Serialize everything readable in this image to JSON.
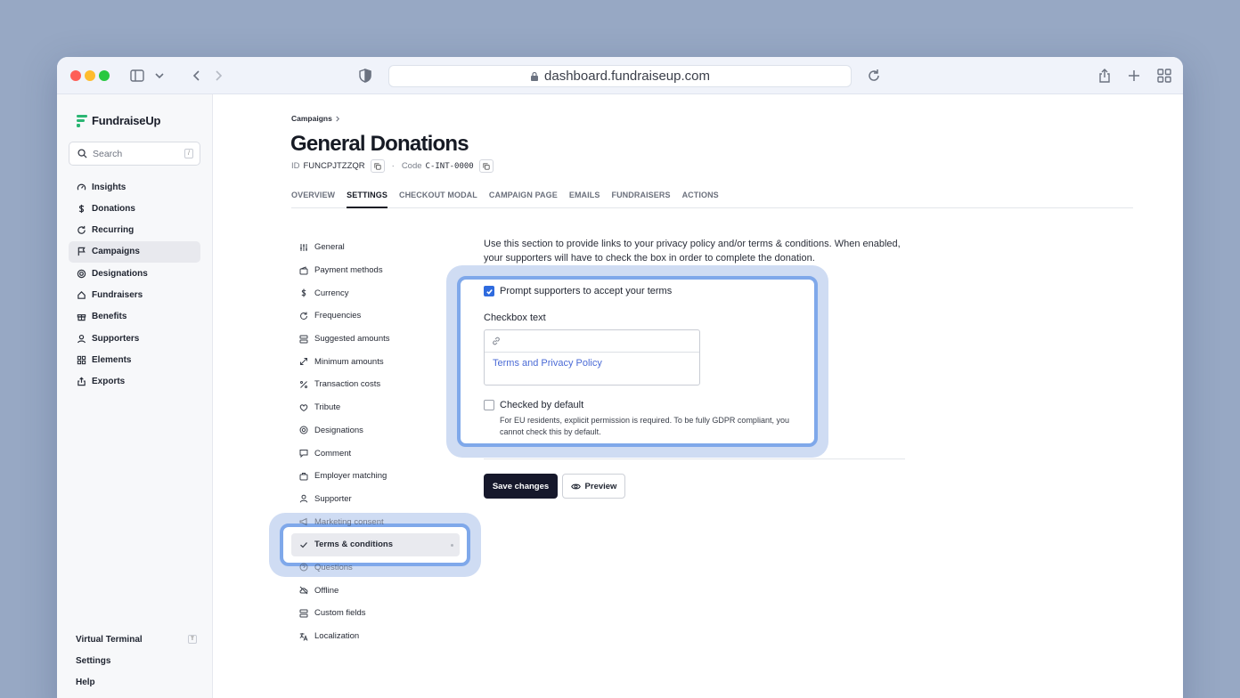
{
  "browser": {
    "url": "dashboard.fundraiseup.com"
  },
  "sidebar": {
    "logo_text": "FundraiseUp",
    "search_placeholder": "Search",
    "search_shortcut": "/",
    "items": [
      {
        "label": "Insights",
        "icon": "gauge-icon"
      },
      {
        "label": "Donations",
        "icon": "dollar-icon"
      },
      {
        "label": "Recurring",
        "icon": "refresh-icon"
      },
      {
        "label": "Campaigns",
        "icon": "flag-icon",
        "active": true
      },
      {
        "label": "Designations",
        "icon": "target-icon"
      },
      {
        "label": "Fundraisers",
        "icon": "fundraiser-icon"
      },
      {
        "label": "Benefits",
        "icon": "gift-icon"
      },
      {
        "label": "Supporters",
        "icon": "user-icon"
      },
      {
        "label": "Elements",
        "icon": "grid-icon"
      },
      {
        "label": "Exports",
        "icon": "export-icon"
      }
    ],
    "bottom": {
      "virtual_terminal": "Virtual Terminal",
      "virtual_terminal_shortcut": "T",
      "settings": "Settings",
      "help": "Help"
    }
  },
  "breadcrumb": {
    "campaigns": "Campaigns"
  },
  "header": {
    "title": "General Donations",
    "id_label": "ID",
    "id_value": "FUNCPJTZZQR",
    "separator": "·",
    "code_label": "Code",
    "code_value": "C-INT-0000"
  },
  "tabs": [
    {
      "label": "OVERVIEW"
    },
    {
      "label": "SETTINGS",
      "active": true
    },
    {
      "label": "CHECKOUT MODAL"
    },
    {
      "label": "CAMPAIGN PAGE"
    },
    {
      "label": "EMAILS"
    },
    {
      "label": "FUNDRAISERS"
    },
    {
      "label": "ACTIONS"
    }
  ],
  "settings_nav": [
    {
      "label": "General",
      "icon": "sliders-icon"
    },
    {
      "label": "Payment methods",
      "icon": "wallet-icon"
    },
    {
      "label": "Currency",
      "icon": "dollar-icon"
    },
    {
      "label": "Frequencies",
      "icon": "refresh-icon"
    },
    {
      "label": "Suggested amounts",
      "icon": "stack-icon"
    },
    {
      "label": "Minimum amounts",
      "icon": "expand-icon"
    },
    {
      "label": "Transaction costs",
      "icon": "percent-icon"
    },
    {
      "label": "Tribute",
      "icon": "heart-icon"
    },
    {
      "label": "Designations",
      "icon": "target-icon"
    },
    {
      "label": "Comment",
      "icon": "comment-icon"
    },
    {
      "label": "Employer matching",
      "icon": "briefcase-icon"
    },
    {
      "label": "Supporter",
      "icon": "user-icon"
    },
    {
      "label": "Marketing consent",
      "icon": "megaphone-icon"
    },
    {
      "label": "Terms & conditions",
      "icon": "check-icon",
      "active": true
    },
    {
      "label": "Questions",
      "icon": "question-icon"
    },
    {
      "label": "Offline",
      "icon": "cloud-off-icon"
    },
    {
      "label": "Custom fields",
      "icon": "fields-icon"
    },
    {
      "label": "Localization",
      "icon": "translate-icon"
    }
  ],
  "terms": {
    "description": "Use this section to provide links to your privacy policy and/or terms & conditions. When enabled, your supporters will have to check the box in order to complete the donation.",
    "prompt_label": "Prompt supporters to accept your terms",
    "prompt_checked": true,
    "checkbox_text_label": "Checkbox text",
    "checkbox_text_value": "Terms and Privacy Policy",
    "checked_default_label": "Checked by default",
    "checked_default_checked": false,
    "checked_default_hint": "For EU residents, explicit permission is required. To be fully GDPR compliant, you cannot check this by default."
  },
  "actions": {
    "save": "Save changes",
    "preview": "Preview"
  },
  "colors": {
    "background": "#97a8c4",
    "accent": "#2f6bde",
    "highlight": "#7fa8ea",
    "primary_button": "#16182b",
    "link": "#4b6bd6"
  }
}
